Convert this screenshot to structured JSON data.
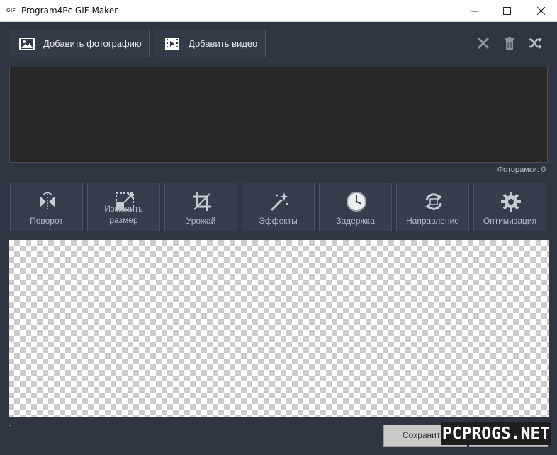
{
  "window": {
    "title": "Program4Pc GIF Maker",
    "app_icon_text": "GIF"
  },
  "toolbar": {
    "add_photo_label": "Добавить фотографию",
    "add_video_label": "Добавить видео"
  },
  "frames": {
    "count_label": "Фоторамки: 0"
  },
  "tools": [
    {
      "label": "Поворот",
      "icon": "rotate-flip-icon"
    },
    {
      "label": "Изменить размер",
      "icon": "resize-icon"
    },
    {
      "label": "Урожай",
      "icon": "crop-icon"
    },
    {
      "label": "Эффекты",
      "icon": "magic-wand-icon"
    },
    {
      "label": "Задержка",
      "icon": "clock-icon"
    },
    {
      "label": "Направление",
      "icon": "direction-icon"
    },
    {
      "label": "Оптимизация",
      "icon": "gear-icon"
    }
  ],
  "bottom": {
    "save_label": "Сохранить",
    "mark": "-"
  },
  "watermark": "PCPROGS.NET",
  "colors": {
    "background": "#2f3543",
    "button": "#363d4c",
    "frames_area": "#282828"
  }
}
